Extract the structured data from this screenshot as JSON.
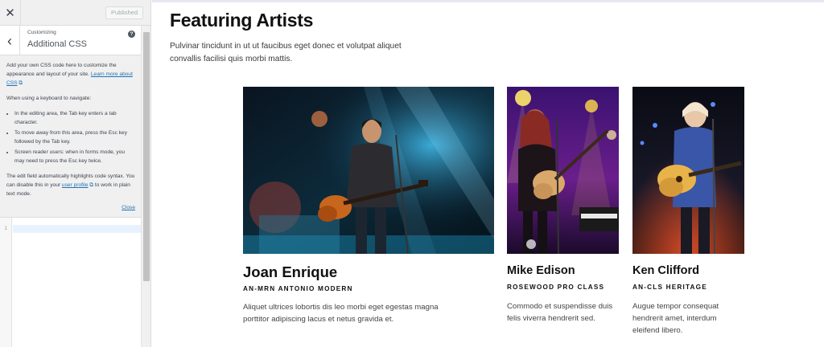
{
  "customizer": {
    "close_glyph": "✕",
    "publish_label": "Published",
    "back_glyph": "‹",
    "breadcrumb": "Customizing",
    "section_title": "Additional CSS",
    "help_glyph": "?",
    "intro_text": "Add your own CSS code here to customize the appearance and layout of your site.",
    "learn_more_link": "Learn more about CSS",
    "keyboard_heading": "When using a keyboard to navigate:",
    "keyboard_tips": [
      "In the editing area, the Tab key enters a tab character.",
      "To move away from this area, press the Esc key followed by the Tab key.",
      "Screen reader users: when in forms mode, you may need to press the Esc key twice."
    ],
    "syntax_text_before": "The edit field automatically highlights code syntax. You can disable this in your",
    "user_profile_link": "user profile",
    "syntax_text_after": "to work in plain text mode.",
    "close_link": "Close",
    "editor_line_number": "1"
  },
  "preview": {
    "title": "Featuring Artists",
    "intro": "Pulvinar tincidunt in ut ut faucibus eget donec et volutpat aliquet convallis facilisi quis morbi mattis.",
    "artists": [
      {
        "name": "Joan Enrique",
        "model": "AN-MRN ANTONIO MODERN",
        "description": "Aliquet ultrices lobortis dis leo morbi eget egestas magna porttitor adipiscing lacus et netus gravida et."
      },
      {
        "name": "Mike Edison",
        "model": "ROSEWOOD PRO CLASS",
        "description": "Commodo et suspendisse duis felis viverra hendrerit sed."
      },
      {
        "name": "Ken Clifford",
        "model": "AN-CLS HERITAGE",
        "description": "Augue tempor consequat hendrerit amet, interdum eleifend libero."
      }
    ]
  },
  "colors": {
    "link": "#2271b1",
    "sidebar_bg": "#f0f0f1",
    "heading": "#111111"
  }
}
